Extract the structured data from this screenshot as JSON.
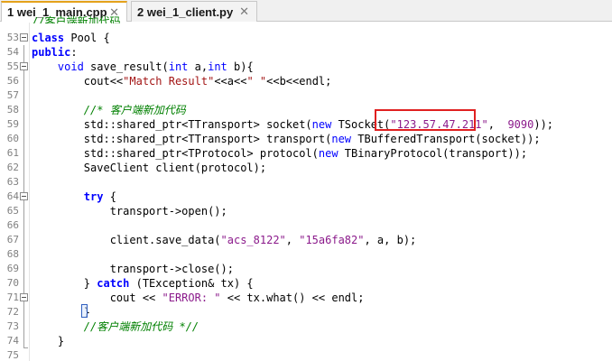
{
  "tabs": [
    {
      "label": "1 wei_1_main.cpp",
      "close": "✕"
    },
    {
      "label": "2 wei_1_client.py",
      "close": "✕"
    }
  ],
  "editor": {
    "top_cut_text": "//客户端新加代码",
    "lines": [
      {
        "num": "53",
        "fold": true
      },
      {
        "num": "54"
      },
      {
        "num": "55",
        "fold": true
      },
      {
        "num": "56"
      },
      {
        "num": "57"
      },
      {
        "num": "58"
      },
      {
        "num": "59"
      },
      {
        "num": "60"
      },
      {
        "num": "61"
      },
      {
        "num": "62"
      },
      {
        "num": "63"
      },
      {
        "num": "64",
        "fold": true
      },
      {
        "num": "65"
      },
      {
        "num": "66"
      },
      {
        "num": "67"
      },
      {
        "num": "68"
      },
      {
        "num": "69"
      },
      {
        "num": "70"
      },
      {
        "num": "71",
        "fold": true
      },
      {
        "num": "72"
      },
      {
        "num": "73"
      },
      {
        "num": "74"
      },
      {
        "num": "75"
      }
    ],
    "code": {
      "l53_kw": "class",
      "l53_rest": " Pool {",
      "l54_kw": "public",
      "l54_rest": ":",
      "l55_pre": "    ",
      "l55_kw": "void",
      "l55_mid": " save_result(",
      "l55_kw2": "int",
      "l55_a": " a,",
      "l55_kw3": "int",
      "l55_b": " b){",
      "l56_pre": "        cout<<",
      "l56_str": "\"Match Result\"",
      "l56_mid": "<<a<<",
      "l56_str2": "\" \"",
      "l56_end": "<<b<<endl;",
      "l58_cmt": "        //* 客户端新加代码",
      "l59_pre": "        std::shared_ptr<TTransport> socket(",
      "l59_kw": "new",
      "l59_mid": " TSocket(",
      "l59_str": "\"123.57.47.211\"",
      "l59_sep": ",  ",
      "l59_num": "9090",
      "l59_end": "));",
      "l60_pre": "        std::shared_ptr<TTransport> transport(",
      "l60_kw": "new",
      "l60_end": " TBufferedTransport(socket));",
      "l61_pre": "        std::shared_ptr<TProtocol> protocol(",
      "l61_kw": "new",
      "l61_end": " TBinaryProtocol(transport));",
      "l62": "        SaveClient client(protocol);",
      "l64_pre": "        ",
      "l64_kw": "try",
      "l64_end": " {",
      "l65": "            transport->open();",
      "l67_pre": "            client.save_data(",
      "l67_s1": "\"acs_8122\"",
      "l67_c": ", ",
      "l67_s2": "\"15a6fa82\"",
      "l67_end": ", a, b);",
      "l69": "            transport->close();",
      "l70_pre": "        } ",
      "l70_kw": "catch",
      "l70_end": " (TException& tx) {",
      "l71_pre": "            cout << ",
      "l71_str": "\"ERROR: \"",
      "l71_end": " << tx.what() << endl;",
      "l72": "        }",
      "l73_cmt": "        //客户端新加代码 *//",
      "l74": "    }"
    }
  },
  "colors": {
    "tab_active_accent": "#e4a21b",
    "highlight_border": "#e02020",
    "keyword": "#0000ff",
    "string": "#a31515",
    "comment": "#008000",
    "number": "#8b1a8b"
  }
}
